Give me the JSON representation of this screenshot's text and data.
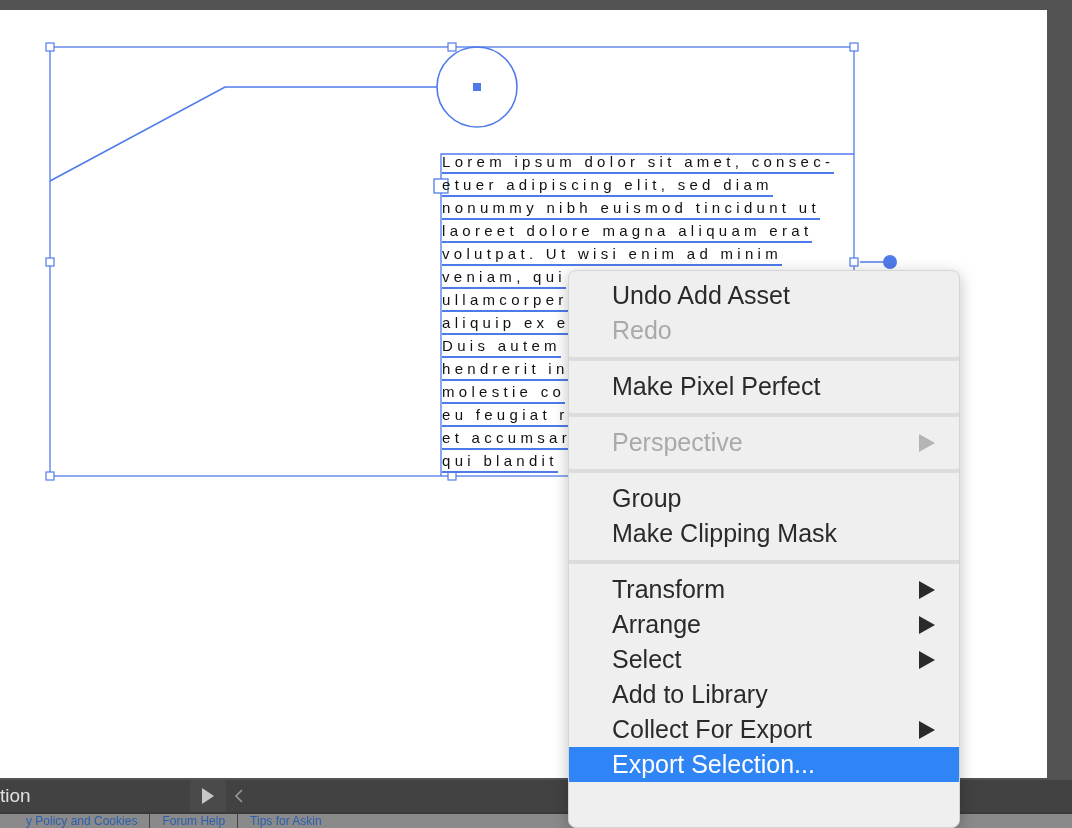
{
  "artboard": {
    "text_frame": {
      "lines": [
        "Lorem ipsum dolor sit amet, consec-",
        "etuer adipiscing elit, sed diam",
        "nonummy nibh euismod tincidunt ut",
        "laoreet dolore magna aliquam erat",
        "volutpat. Ut wisi enim ad minim",
        "veniam, qui",
        "ullamcorper",
        "aliquip ex e",
        "Duis autem",
        "hendrerit in",
        "molestie co",
        "eu feugiat r",
        "et accumsar",
        "qui blandit"
      ]
    }
  },
  "context_menu": {
    "items": [
      {
        "kind": "item",
        "label": "Undo Add Asset",
        "disabled": false,
        "submenu": false,
        "selected": false
      },
      {
        "kind": "item",
        "label": "Redo",
        "disabled": true,
        "submenu": false,
        "selected": false
      },
      {
        "kind": "separator"
      },
      {
        "kind": "item",
        "label": "Make Pixel Perfect",
        "disabled": false,
        "submenu": false,
        "selected": false
      },
      {
        "kind": "separator"
      },
      {
        "kind": "item",
        "label": "Perspective",
        "disabled": true,
        "submenu": true,
        "selected": false
      },
      {
        "kind": "separator"
      },
      {
        "kind": "item",
        "label": "Group",
        "disabled": false,
        "submenu": false,
        "selected": false
      },
      {
        "kind": "item",
        "label": "Make Clipping Mask",
        "disabled": false,
        "submenu": false,
        "selected": false
      },
      {
        "kind": "separator"
      },
      {
        "kind": "item",
        "label": "Transform",
        "disabled": false,
        "submenu": true,
        "selected": false
      },
      {
        "kind": "item",
        "label": "Arrange",
        "disabled": false,
        "submenu": true,
        "selected": false
      },
      {
        "kind": "item",
        "label": "Select",
        "disabled": false,
        "submenu": true,
        "selected": false
      },
      {
        "kind": "item",
        "label": "Add to Library",
        "disabled": false,
        "submenu": false,
        "selected": false
      },
      {
        "kind": "item",
        "label": "Collect For Export",
        "disabled": false,
        "submenu": true,
        "selected": false
      },
      {
        "kind": "item",
        "label": "Export Selection...",
        "disabled": false,
        "submenu": false,
        "selected": true
      }
    ]
  },
  "status_bar": {
    "label": "tion"
  },
  "footer_links": [
    "y Policy and Cookies",
    "Forum Help",
    "Tips for Askin"
  ]
}
